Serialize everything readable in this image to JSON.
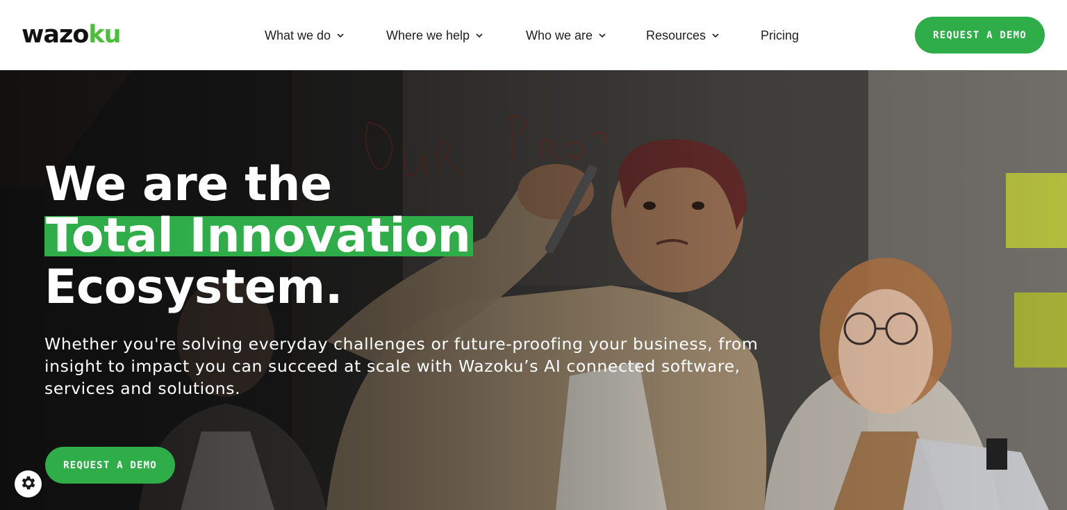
{
  "header": {
    "logo": {
      "part1": "wazo",
      "part2": "ku"
    },
    "nav": [
      {
        "label": "What we do",
        "has_dropdown": true
      },
      {
        "label": "Where we help",
        "has_dropdown": true
      },
      {
        "label": "Who we are",
        "has_dropdown": true
      },
      {
        "label": "Resources",
        "has_dropdown": true
      },
      {
        "label": "Pricing",
        "has_dropdown": false
      }
    ],
    "cta_label": "REQUEST A DEMO"
  },
  "hero": {
    "headline_line1": "We are the",
    "headline_highlight": "Total Innovation",
    "headline_line3": "Ecosystem.",
    "subtext": "Whether you're solving everyday challenges or future-proofing your business, from insight to impact you can succeed at scale with Wazoku’s AI connected software, services and solutions.",
    "cta_label": "REQUEST A DEMO"
  },
  "icons": {
    "dropdown": "chevron-down-icon",
    "cookie_settings": "gear-icon"
  },
  "colors": {
    "brand_green": "#2fad48",
    "logo_green": "#4bbf3c",
    "text_dark": "#1e1e1e"
  }
}
